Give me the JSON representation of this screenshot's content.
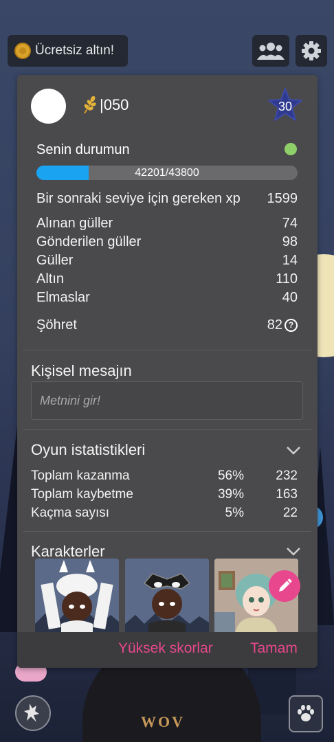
{
  "topbar": {
    "free_gold_label": "Ücretsiz altın!"
  },
  "profile": {
    "username": "|050",
    "level": "30",
    "status_label": "Senin durumun",
    "xp_text": "42201/43800",
    "xp_progress": 0.2
  },
  "stats": [
    {
      "label": "Bir sonraki seviye için gereken xp",
      "value": "1599"
    },
    {
      "label": "Alınan güller",
      "value": "74"
    },
    {
      "label": "Gönderilen güller",
      "value": "98"
    },
    {
      "label": "Güller",
      "value": "14"
    },
    {
      "label": "Altın",
      "value": "110"
    },
    {
      "label": "Elmaslar",
      "value": "40"
    },
    {
      "label": "Şöhret",
      "value": "82"
    }
  ],
  "personal_message": {
    "title": "Kişisel mesajın",
    "placeholder": "Metnini gir!"
  },
  "game_stats": {
    "title": "Oyun istatistikleri",
    "rows": [
      {
        "label": "Toplam kazanma",
        "percent": "56%",
        "count": "232"
      },
      {
        "label": "Toplam kaybetme",
        "percent": "39%",
        "count": "163"
      },
      {
        "label": "Kaçma sayısı",
        "percent": "5%",
        "count": "22"
      }
    ]
  },
  "characters": {
    "title": "Karakterler"
  },
  "buttons": {
    "high_scores": "Yüksek skorlar",
    "ok": "Tamam"
  },
  "background": {
    "logo_text": "WOV"
  },
  "colors": {
    "accent_pink": "#e8478d",
    "xp_blue": "#1aa3f0",
    "status_green": "#8fcf6a",
    "level_star": "#2f3a8f"
  }
}
